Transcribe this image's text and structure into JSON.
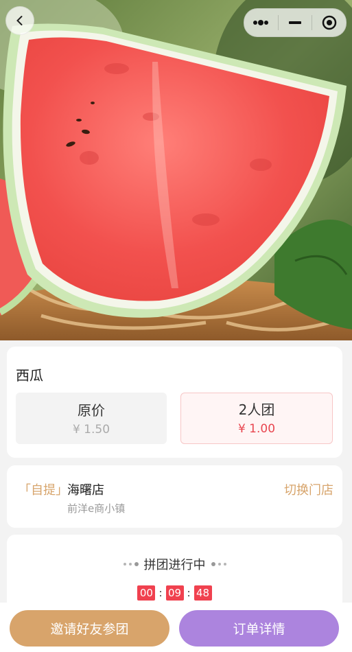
{
  "hero": {
    "image": "watermelon-slice-photo"
  },
  "nav": {
    "back_icon": "chevron-left-icon",
    "more_icon": "more-dots-icon",
    "minimize_icon": "minus-icon",
    "close_icon": "target-circle-icon"
  },
  "product": {
    "name": "西瓜",
    "original_label": "原价",
    "original_price": "¥ 1.50",
    "group_label": "2人团",
    "group_price": "¥ 1.00"
  },
  "store": {
    "tag": "「自提」",
    "name": "海曙店",
    "address": "前洋e商小镇",
    "switch_label": "切换门店"
  },
  "status": {
    "text": "拼团进行中",
    "hours": "00",
    "minutes": "09",
    "seconds": "48",
    "colon": ":"
  },
  "actions": {
    "invite_label": "邀请好友参团",
    "order_label": "订单详情"
  },
  "colors": {
    "accent_gold": "#d8a46b",
    "accent_purple": "#ac84de",
    "price_red": "#e8454f"
  }
}
